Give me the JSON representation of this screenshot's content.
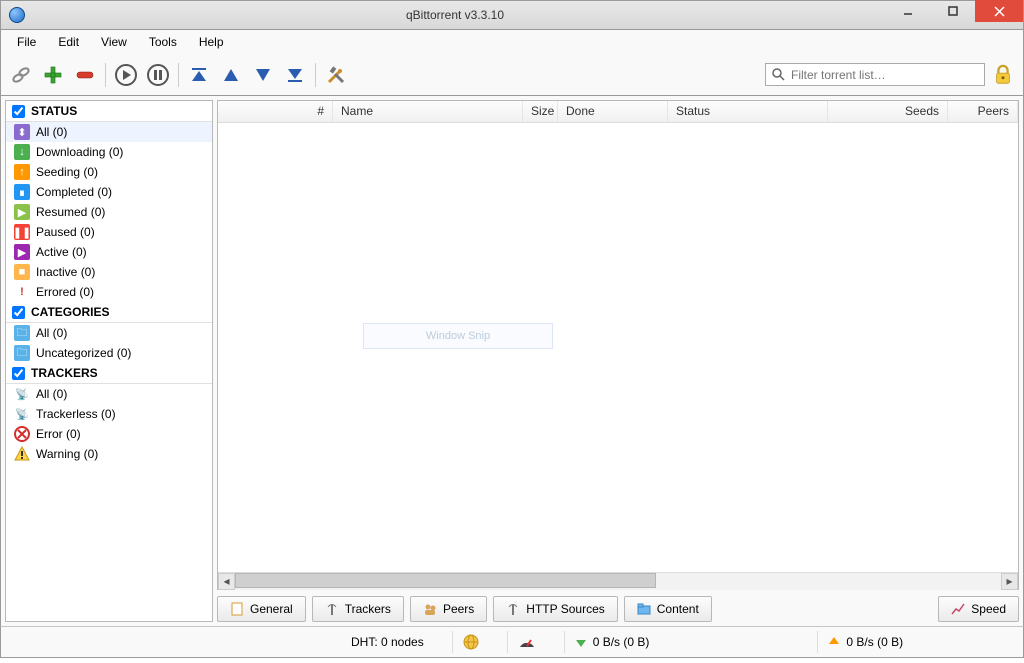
{
  "window": {
    "title": "qBittorrent v3.3.10"
  },
  "menu": {
    "file": "File",
    "edit": "Edit",
    "view": "View",
    "tools": "Tools",
    "help": "Help"
  },
  "toolbar": {
    "search_placeholder": "Filter torrent list…"
  },
  "sidebar": {
    "status_header": "STATUS",
    "status": [
      {
        "label": "All (0)"
      },
      {
        "label": "Downloading (0)"
      },
      {
        "label": "Seeding (0)"
      },
      {
        "label": "Completed (0)"
      },
      {
        "label": "Resumed (0)"
      },
      {
        "label": "Paused (0)"
      },
      {
        "label": "Active (0)"
      },
      {
        "label": "Inactive (0)"
      },
      {
        "label": "Errored (0)"
      }
    ],
    "categories_header": "CATEGORIES",
    "categories": [
      {
        "label": "All (0)"
      },
      {
        "label": "Uncategorized (0)"
      }
    ],
    "trackers_header": "TRACKERS",
    "trackers": [
      {
        "label": "All (0)"
      },
      {
        "label": "Trackerless (0)"
      },
      {
        "label": "Error (0)"
      },
      {
        "label": "Warning (0)"
      }
    ]
  },
  "columns": {
    "hash": "#",
    "name": "Name",
    "size": "Size",
    "done": "Done",
    "status": "Status",
    "seeds": "Seeds",
    "peers": "Peers"
  },
  "watermark": "Window Snip",
  "tabs": {
    "general": "General",
    "trackers": "Trackers",
    "peers": "Peers",
    "http": "HTTP Sources",
    "content": "Content",
    "speed": "Speed"
  },
  "status": {
    "dht": "DHT: 0 nodes",
    "down": "0 B/s (0 B)",
    "up": "0 B/s (0 B)"
  }
}
